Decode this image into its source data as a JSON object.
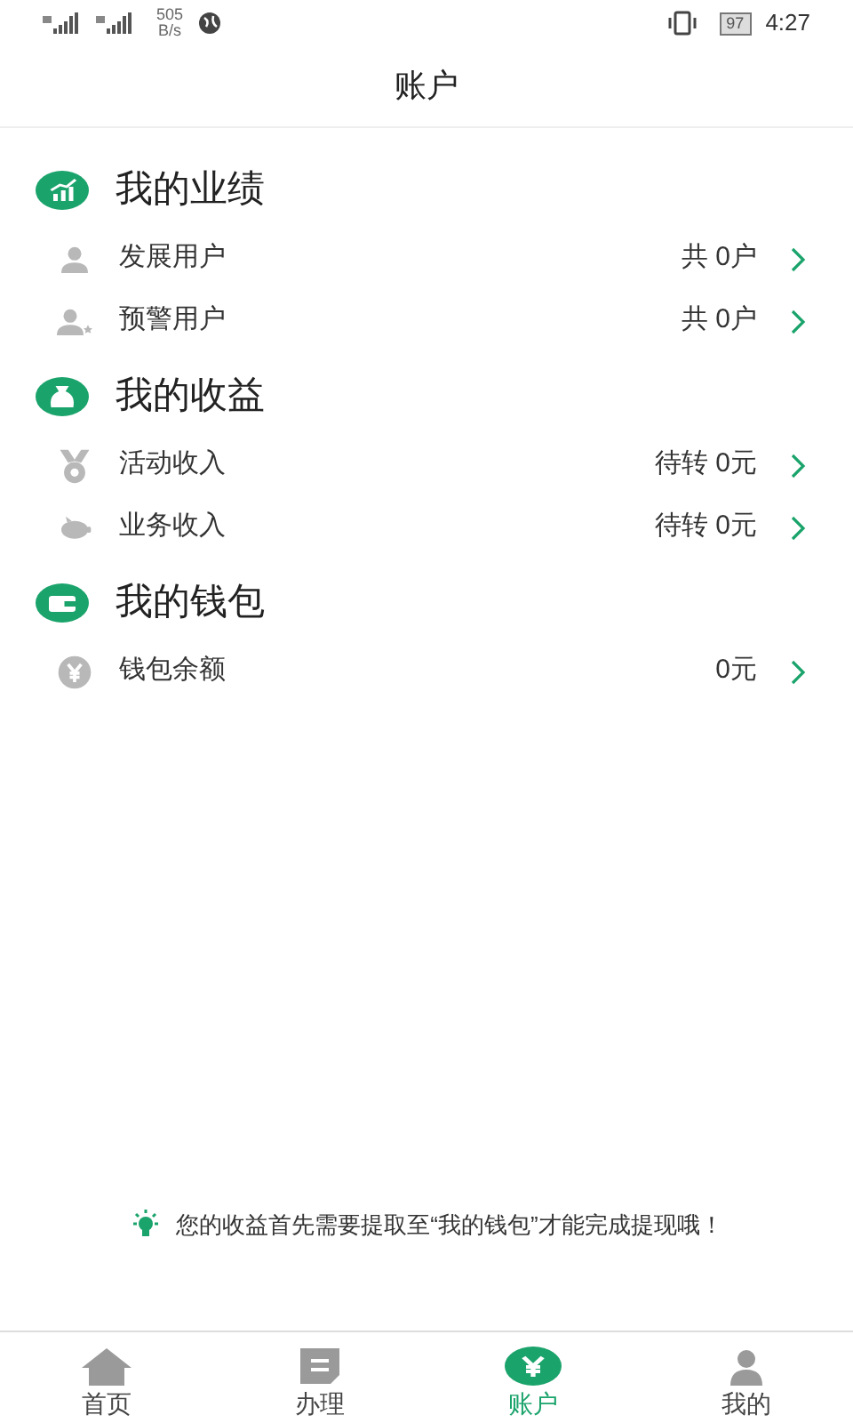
{
  "status_bar": {
    "speed": "505",
    "speed_unit": "B/s",
    "battery": "97",
    "time": "4:27"
  },
  "header": {
    "title": "账户"
  },
  "sections": [
    {
      "title": "我的业绩",
      "kind": "chart",
      "rows": [
        {
          "label": "发展用户",
          "value": "共 0户",
          "kind": "user"
        },
        {
          "label": "预警用户",
          "value": "共 0户",
          "kind": "user-star"
        }
      ]
    },
    {
      "title": "我的收益",
      "kind": "moneybag",
      "rows": [
        {
          "label": "活动收入",
          "value": "待转 0元",
          "kind": "medal"
        },
        {
          "label": "业务收入",
          "value": "待转 0元",
          "kind": "piggy"
        }
      ]
    },
    {
      "title": "我的钱包",
      "kind": "wallet",
      "rows": [
        {
          "label": "钱包余额",
          "value": "0元",
          "kind": "coin"
        }
      ]
    }
  ],
  "tip": "您的收益首先需要提取至“我的钱包”才能完成提现哦！",
  "tabs": [
    {
      "label": "首页",
      "kind": "home",
      "selected": false
    },
    {
      "label": "办理",
      "kind": "doc",
      "selected": false
    },
    {
      "label": "账户",
      "kind": "coin",
      "selected": true
    },
    {
      "label": "我的",
      "kind": "user",
      "selected": false
    }
  ]
}
